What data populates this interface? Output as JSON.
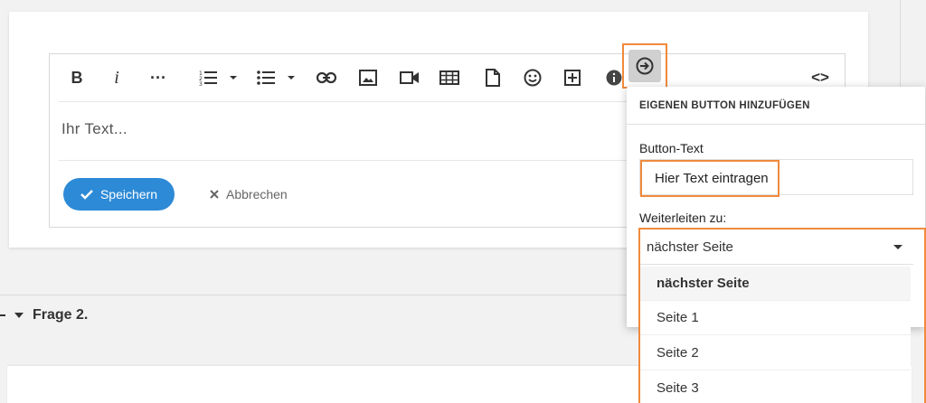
{
  "editor": {
    "placeholder_text": "Ihr Text...",
    "save_label": "Speichern",
    "cancel_label": "Abbrechen"
  },
  "toolbar": {
    "bold_label": "B",
    "italic_label": "i",
    "more_label": "···",
    "code_label": "<>"
  },
  "section": {
    "title": "Frage 2."
  },
  "popover": {
    "header": "EIGENEN BUTTON HINZUFÜGEN",
    "button_text_label": "Button-Text",
    "button_text_value": "Hier Text eintragen",
    "redirect_label": "Weiterleiten zu:",
    "redirect_selected": "nächster Seite",
    "options": [
      "nächster Seite",
      "Seite 1",
      "Seite 2",
      "Seite 3"
    ]
  },
  "colors": {
    "accent": "#2d8ad6",
    "highlight": "#f08a3c"
  }
}
